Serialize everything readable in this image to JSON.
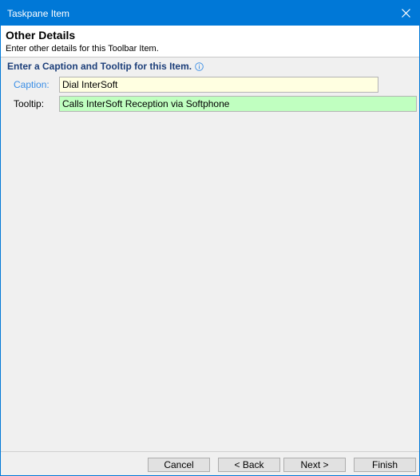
{
  "window": {
    "title": "Taskpane Item"
  },
  "header": {
    "title": "Other Details",
    "subtitle": "Enter other details for this Toolbar Item."
  },
  "section": {
    "title": "Enter a Caption and Tooltip for this Item."
  },
  "fields": {
    "caption": {
      "label": "Caption:",
      "value": "Dial InterSoft"
    },
    "tooltip": {
      "label": "Tooltip:",
      "value": "Calls InterSoft Reception via Softphone"
    }
  },
  "buttons": {
    "cancel": "Cancel",
    "back": "< Back",
    "next": "Next >",
    "finish": "Finish"
  },
  "icons": {
    "close": "close-icon",
    "info": "info-icon"
  },
  "colors": {
    "titlebar": "#0078d7",
    "caption_label": "#3a8ee6",
    "caption_field": "#ffffe1",
    "tooltip_field": "#c0ffc0",
    "section_title": "#1d3f7a"
  }
}
